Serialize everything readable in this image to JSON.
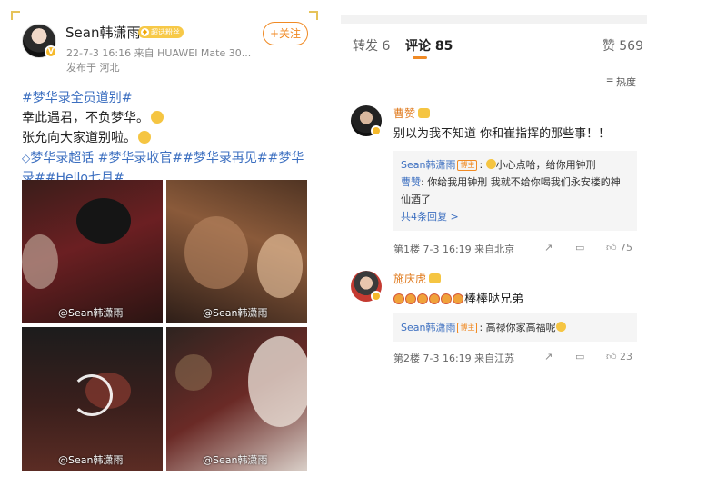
{
  "post": {
    "author": "Sean韩潇雨",
    "badge": "超话粉丝",
    "follow_label": "+关注",
    "meta_line": "22-7-3 16:16  来自 HUAWEI Mate 30...",
    "location": "发布于 河北",
    "topic_main": "#梦华录全员道别#",
    "line1": "幸此遇君，不负梦华。",
    "line2": "张允向大家道别啦。",
    "topics_prefix": "梦华录超话",
    "topics_rest": " #梦华录收官##梦华录再见##梦华录##Hello七月#",
    "watermark": "@Sean韩潇雨"
  },
  "comments_panel": {
    "tab_repost": "转发 6",
    "tab_comment": "评论 85",
    "tab_like": "赞 569",
    "sort_label": "热度",
    "comments": [
      {
        "name": "曹赞",
        "text": "别以为我不知道 你和崔指挥的那些事！！",
        "replies": [
          {
            "name": "Sean韩潇雨",
            "tag": "博主",
            "text": "小心点哈，给你用钟刑"
          },
          {
            "name": "曹赞",
            "tag": "",
            "text": "你给我用钟刑 我就不给你喝我们永安楼的神仙酒了"
          }
        ],
        "more": "共4条回复 >",
        "footer": "第1楼 7-3 16:19 来自北京",
        "likes": "75"
      },
      {
        "name": "施庆虎",
        "text": "棒棒哒兄弟",
        "replies": [
          {
            "name": "Sean韩潇雨",
            "tag": "博主",
            "text": "高禄你家高福呢"
          }
        ],
        "footer": "第2楼 7-3 16:19 来自江苏",
        "likes": "23"
      }
    ]
  }
}
